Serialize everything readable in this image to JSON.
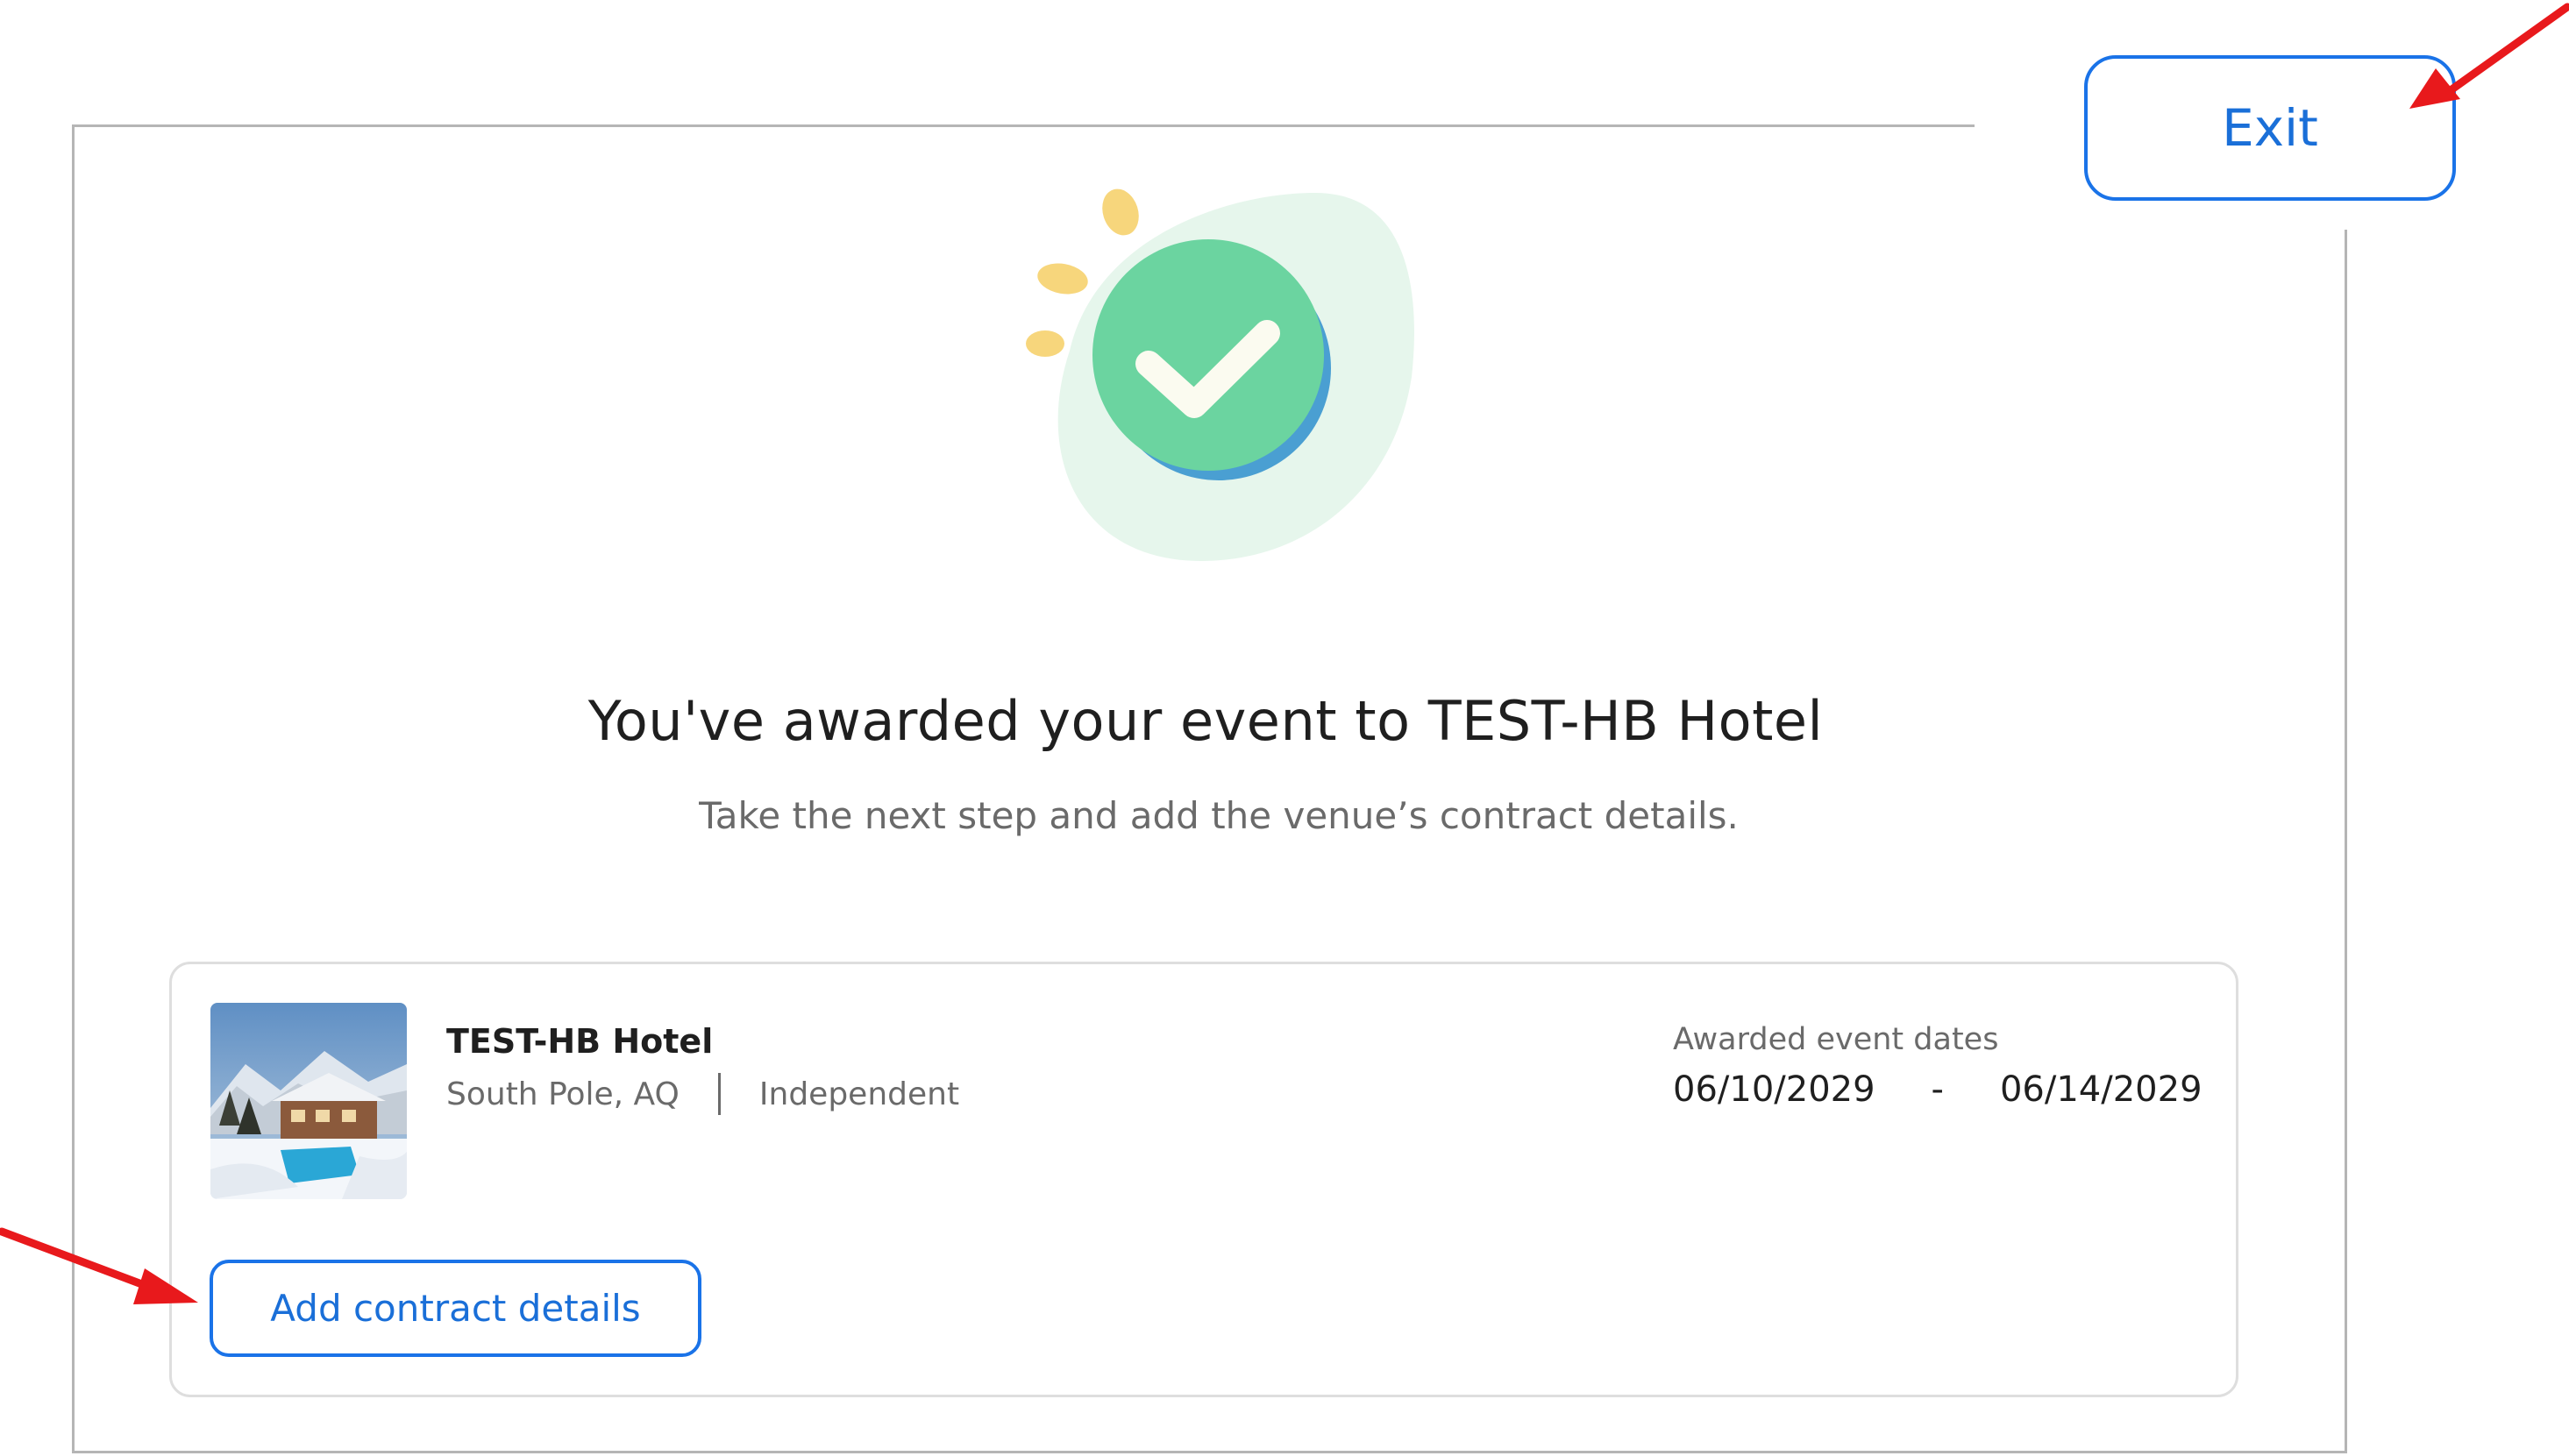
{
  "header": {
    "exit_label": "Exit"
  },
  "confirmation": {
    "headline": "You've awarded your event to TEST-HB Hotel",
    "subtext": "Take the next step and add the venue’s contract details."
  },
  "venue": {
    "name": "TEST-HB Hotel",
    "location": "South Pole, AQ",
    "type": "Independent",
    "dates_label": "Awarded event dates",
    "start_date": "06/10/2029",
    "date_separator": "-",
    "end_date": "06/14/2029",
    "action_label": "Add contract details"
  },
  "colors": {
    "accent": "#1a73e8",
    "check_green": "#6bd4a0",
    "check_shadow": "#4a9fd2",
    "blob": "#e6f6ec",
    "spark": "#f7d67c",
    "arrow": "#e8191c"
  }
}
